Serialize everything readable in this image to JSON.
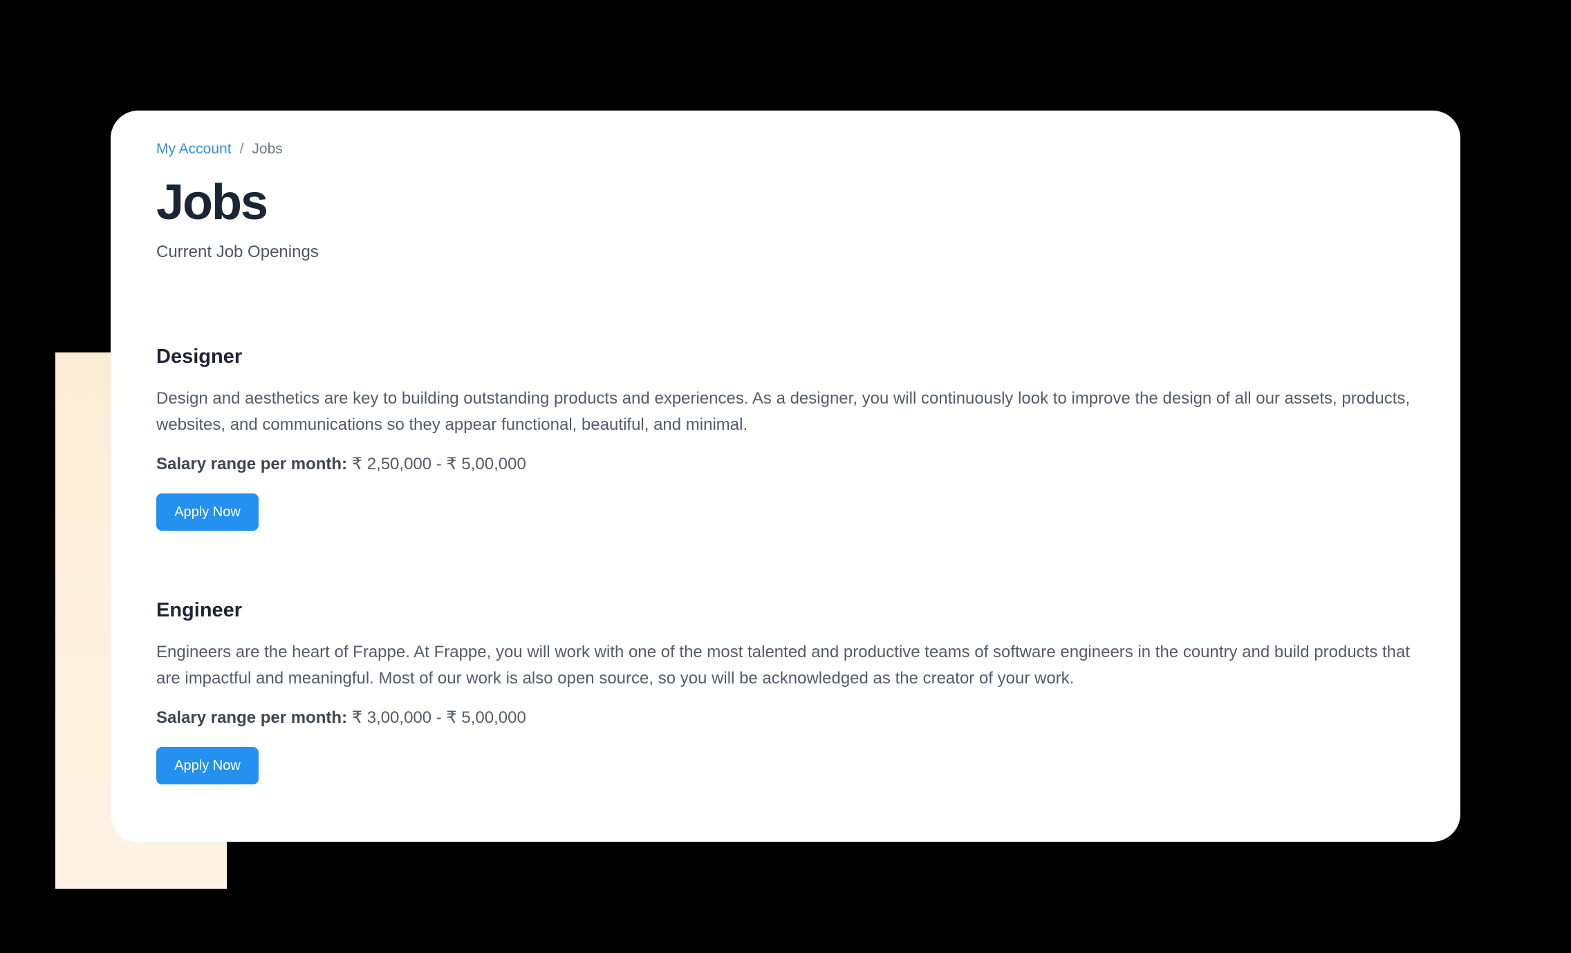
{
  "breadcrumb": {
    "parent": "My Account",
    "separator": "/",
    "current": "Jobs"
  },
  "page": {
    "title": "Jobs",
    "subtitle": "Current Job Openings"
  },
  "jobs": [
    {
      "title": "Designer",
      "description": "Design and aesthetics are key to building outstanding products and experiences. As a designer, you will continuously look to improve the design of all our assets, products, websites, and communications so they appear functional, beautiful, and minimal.",
      "salary_label": "Salary range per month:",
      "salary_value": "₹ 2,50,000 - ₹ 5,00,000",
      "apply_label": "Apply Now"
    },
    {
      "title": "Engineer",
      "description": "Engineers are the heart of Frappe. At Frappe, you will work with one of the most talented and productive teams of software engineers in the country and build products that are impactful and meaningful. Most of our work is also open source, so you will be acknowledged as the creator of your work.",
      "salary_label": "Salary range per month:",
      "salary_value": "₹ 3,00,000 - ₹ 5,00,000",
      "apply_label": "Apply Now"
    }
  ],
  "colors": {
    "accent": "#2490ef",
    "link": "#2f8fd8",
    "heading": "#1b2533",
    "body_text": "#525c69",
    "backdrop": "#000000",
    "decor_block": "#fcecd6"
  }
}
